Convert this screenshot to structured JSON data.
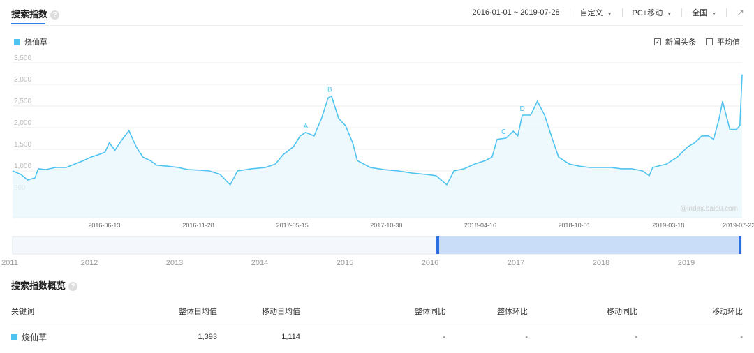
{
  "header": {
    "title": "搜索指数",
    "date_range": "2016-01-01 ~ 2019-07-28",
    "period": "自定义",
    "device": "PC+移动",
    "region": "全国"
  },
  "legend": {
    "keyword": "烧仙草",
    "color": "#4fc3ef"
  },
  "options": [
    {
      "label": "新闻头条",
      "checked": true
    },
    {
      "label": "平均值",
      "checked": false
    }
  ],
  "chart_data": {
    "type": "area",
    "x_unit": "days since 2016-01-01",
    "ylim": [
      0,
      3500
    ],
    "y_ticks": [
      "3,500",
      "3,000",
      "2,500",
      "2,000",
      "1,500",
      "1,000",
      "500"
    ],
    "y_tick_values": [
      3500,
      3000,
      2500,
      2000,
      1500,
      1000,
      500
    ],
    "x_ticks": [
      {
        "label": "2016-06-13",
        "day": 164
      },
      {
        "label": "2016-11-28",
        "day": 332
      },
      {
        "label": "2017-05-15",
        "day": 500
      },
      {
        "label": "2017-10-30",
        "day": 668
      },
      {
        "label": "2018-04-16",
        "day": 836
      },
      {
        "label": "2018-10-01",
        "day": 1004
      },
      {
        "label": "2019-03-18",
        "day": 1172
      },
      {
        "label": "2019-07-22",
        "day": 1298
      }
    ],
    "total_days": 1304,
    "watermark": "@index.baidu.com",
    "annotations": [
      {
        "label": "A",
        "day": 524,
        "value": 1890
      },
      {
        "label": "B",
        "day": 567,
        "value": 2730
      },
      {
        "label": "C",
        "day": 878,
        "value": 1760
      },
      {
        "label": "D",
        "day": 911,
        "value": 2290
      }
    ],
    "series": [
      {
        "name": "烧仙草",
        "points": [
          [
            0,
            1000
          ],
          [
            15,
            920
          ],
          [
            27,
            790
          ],
          [
            40,
            840
          ],
          [
            46,
            1050
          ],
          [
            59,
            1030
          ],
          [
            77,
            1080
          ],
          [
            96,
            1080
          ],
          [
            109,
            1150
          ],
          [
            127,
            1240
          ],
          [
            140,
            1320
          ],
          [
            152,
            1370
          ],
          [
            165,
            1430
          ],
          [
            173,
            1650
          ],
          [
            183,
            1480
          ],
          [
            196,
            1730
          ],
          [
            208,
            1930
          ],
          [
            221,
            1560
          ],
          [
            233,
            1320
          ],
          [
            246,
            1240
          ],
          [
            258,
            1130
          ],
          [
            277,
            1110
          ],
          [
            296,
            1080
          ],
          [
            314,
            1030
          ],
          [
            333,
            1020
          ],
          [
            352,
            1000
          ],
          [
            371,
            920
          ],
          [
            389,
            680
          ],
          [
            402,
            1000
          ],
          [
            427,
            1050
          ],
          [
            452,
            1080
          ],
          [
            470,
            1160
          ],
          [
            483,
            1370
          ],
          [
            502,
            1560
          ],
          [
            514,
            1810
          ],
          [
            524,
            1890
          ],
          [
            539,
            1810
          ],
          [
            552,
            2210
          ],
          [
            564,
            2690
          ],
          [
            570,
            2730
          ],
          [
            583,
            2210
          ],
          [
            595,
            2050
          ],
          [
            608,
            1650
          ],
          [
            616,
            1240
          ],
          [
            639,
            1080
          ],
          [
            664,
            1030
          ],
          [
            689,
            1000
          ],
          [
            714,
            950
          ],
          [
            739,
            920
          ],
          [
            757,
            890
          ],
          [
            776,
            680
          ],
          [
            789,
            1000
          ],
          [
            807,
            1050
          ],
          [
            826,
            1160
          ],
          [
            845,
            1240
          ],
          [
            857,
            1320
          ],
          [
            866,
            1730
          ],
          [
            882,
            1760
          ],
          [
            895,
            1920
          ],
          [
            903,
            1810
          ],
          [
            911,
            2290
          ],
          [
            926,
            2290
          ],
          [
            938,
            2610
          ],
          [
            951,
            2290
          ],
          [
            963,
            1810
          ],
          [
            976,
            1320
          ],
          [
            995,
            1160
          ],
          [
            1013,
            1110
          ],
          [
            1032,
            1080
          ],
          [
            1051,
            1080
          ],
          [
            1070,
            1080
          ],
          [
            1088,
            1050
          ],
          [
            1107,
            1050
          ],
          [
            1126,
            1000
          ],
          [
            1138,
            890
          ],
          [
            1144,
            1080
          ],
          [
            1169,
            1160
          ],
          [
            1188,
            1320
          ],
          [
            1207,
            1560
          ],
          [
            1219,
            1650
          ],
          [
            1232,
            1810
          ],
          [
            1244,
            1810
          ],
          [
            1253,
            1730
          ],
          [
            1263,
            2210
          ],
          [
            1269,
            2610
          ],
          [
            1282,
            1960
          ],
          [
            1294,
            1960
          ],
          [
            1300,
            2050
          ],
          [
            1304,
            3230
          ]
        ]
      }
    ]
  },
  "timeline": {
    "years": [
      "2011",
      "2012",
      "2013",
      "2014",
      "2015",
      "2016",
      "2017",
      "2018",
      "2019"
    ],
    "selected_from": "2016",
    "selected_to": "2019-07"
  },
  "overview": {
    "title": "搜索指数概览",
    "columns": [
      "关键词",
      "整体日均值",
      "移动日均值",
      "整体同比",
      "整体环比",
      "移动同比",
      "移动环比"
    ],
    "rows": [
      {
        "keyword": "烧仙草",
        "overall_avg": "1,393",
        "mobile_avg": "1,114",
        "overall_yoy": "-",
        "overall_mom": "-",
        "mobile_yoy": "-",
        "mobile_mom": "-"
      }
    ]
  }
}
